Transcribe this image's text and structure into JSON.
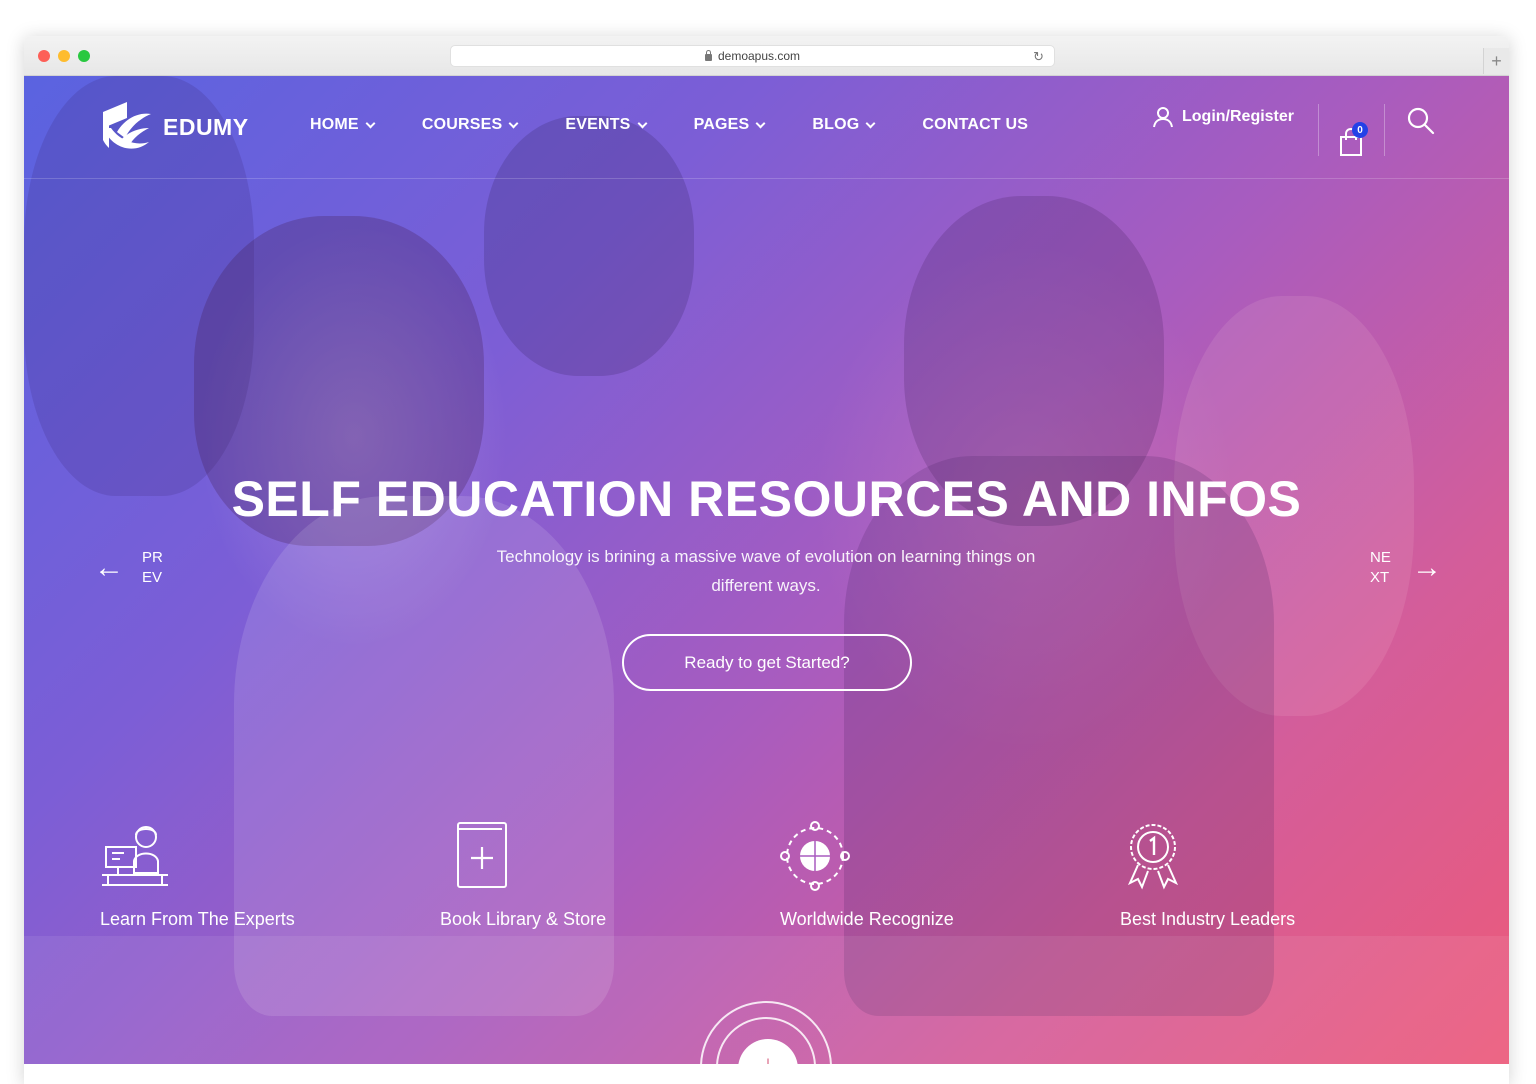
{
  "browser": {
    "url": "demoapus.com",
    "newtab_label": "+"
  },
  "nav": {
    "logo_text": "EDUMY",
    "menu": [
      {
        "label": "HOME",
        "has_dropdown": true
      },
      {
        "label": "COURSES",
        "has_dropdown": true
      },
      {
        "label": "EVENTS",
        "has_dropdown": true
      },
      {
        "label": "PAGES",
        "has_dropdown": true
      },
      {
        "label": "BLOG",
        "has_dropdown": true
      },
      {
        "label": "CONTACT US",
        "has_dropdown": false
      }
    ],
    "login_label": "Login/Register",
    "cart_count": "0",
    "icons": [
      "user-icon",
      "shopping-bag-icon",
      "search-icon"
    ]
  },
  "hero": {
    "headline": "SELF EDUCATION RESOURCES AND INFOS",
    "subtext": "Technology is brining a massive wave of evolution on learning things on different ways.",
    "cta_label": "Ready to get Started?",
    "prev_label": "PREV",
    "next_label": "NEXT",
    "gradient_colors": [
      "#5a63e0",
      "#a85cbf",
      "#ec5a7a"
    ]
  },
  "features": [
    {
      "label": "Learn From The Experts",
      "icon": "expert-desk-icon"
    },
    {
      "label": "Book Library & Store",
      "icon": "book-plus-icon"
    },
    {
      "label": "Worldwide Recognize",
      "icon": "globe-network-icon"
    },
    {
      "label": "Best Industry Leaders",
      "icon": "award-medal-icon"
    }
  ],
  "scroll_icon": "arrow-down-icon"
}
